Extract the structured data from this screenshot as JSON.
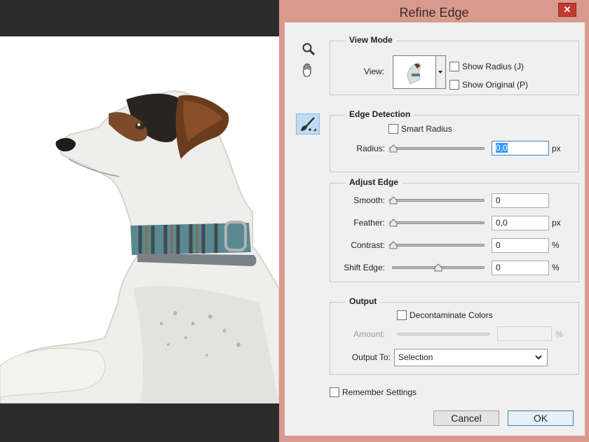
{
  "dialog": {
    "title": "Refine Edge",
    "close_glyph": "✕"
  },
  "tools": [
    "zoom-tool-icon",
    "hand-tool-icon",
    "refine-radius-brush-icon"
  ],
  "view_mode": {
    "title": "View Mode",
    "view_label": "View:",
    "show_radius": "Show Radius (J)",
    "show_original": "Show Original (P)"
  },
  "edge_detection": {
    "title": "Edge Detection",
    "smart_radius": "Smart Radius",
    "radius_label": "Radius:",
    "radius_value": "0,0",
    "radius_unit": "px"
  },
  "adjust_edge": {
    "title": "Adjust Edge",
    "smooth_label": "Smooth:",
    "smooth_value": "0",
    "feather_label": "Feather:",
    "feather_value": "0,0",
    "feather_unit": "px",
    "contrast_label": "Contrast:",
    "contrast_value": "0",
    "contrast_unit": "%",
    "shift_label": "Shift Edge:",
    "shift_value": "0",
    "shift_unit": "%"
  },
  "output": {
    "title": "Output",
    "decontaminate": "Decontaminate Colors",
    "amount_label": "Amount:",
    "amount_unit": "%",
    "output_to_label": "Output To:",
    "output_to_value": "Selection"
  },
  "remember_settings": "Remember Settings",
  "buttons": {
    "cancel": "Cancel",
    "ok": "OK"
  },
  "colors": {
    "frame": "#d99a8e",
    "close": "#c23b2e",
    "selection": "#3399ff",
    "canvas_bg": "#2b2b2b"
  }
}
